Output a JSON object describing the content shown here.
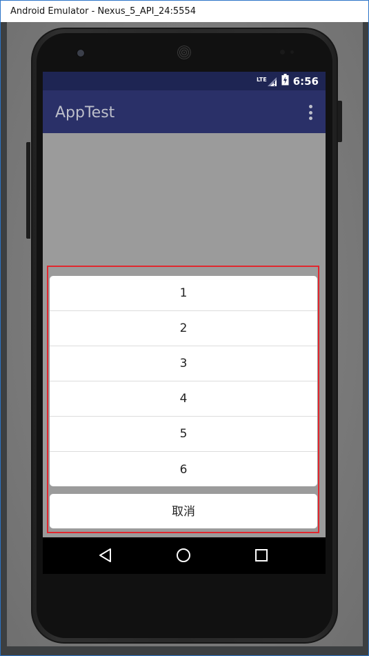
{
  "window": {
    "title": "Android Emulator - Nexus_5_API_24:5554"
  },
  "status_bar": {
    "network": "LTE",
    "time": "6:56"
  },
  "app_bar": {
    "title": "AppTest",
    "overflow_icon": "more-vert-icon"
  },
  "action_sheet": {
    "items": [
      "1",
      "2",
      "3",
      "4",
      "5",
      "6"
    ],
    "cancel_label": "取消"
  },
  "nav_bar": {
    "icons": [
      "back-icon",
      "home-icon",
      "recents-icon"
    ]
  },
  "colors": {
    "status_bar": "#1e2553",
    "app_bar": "#2a3068",
    "highlight": "#e2272e",
    "scrim": "#9b9b9b"
  }
}
